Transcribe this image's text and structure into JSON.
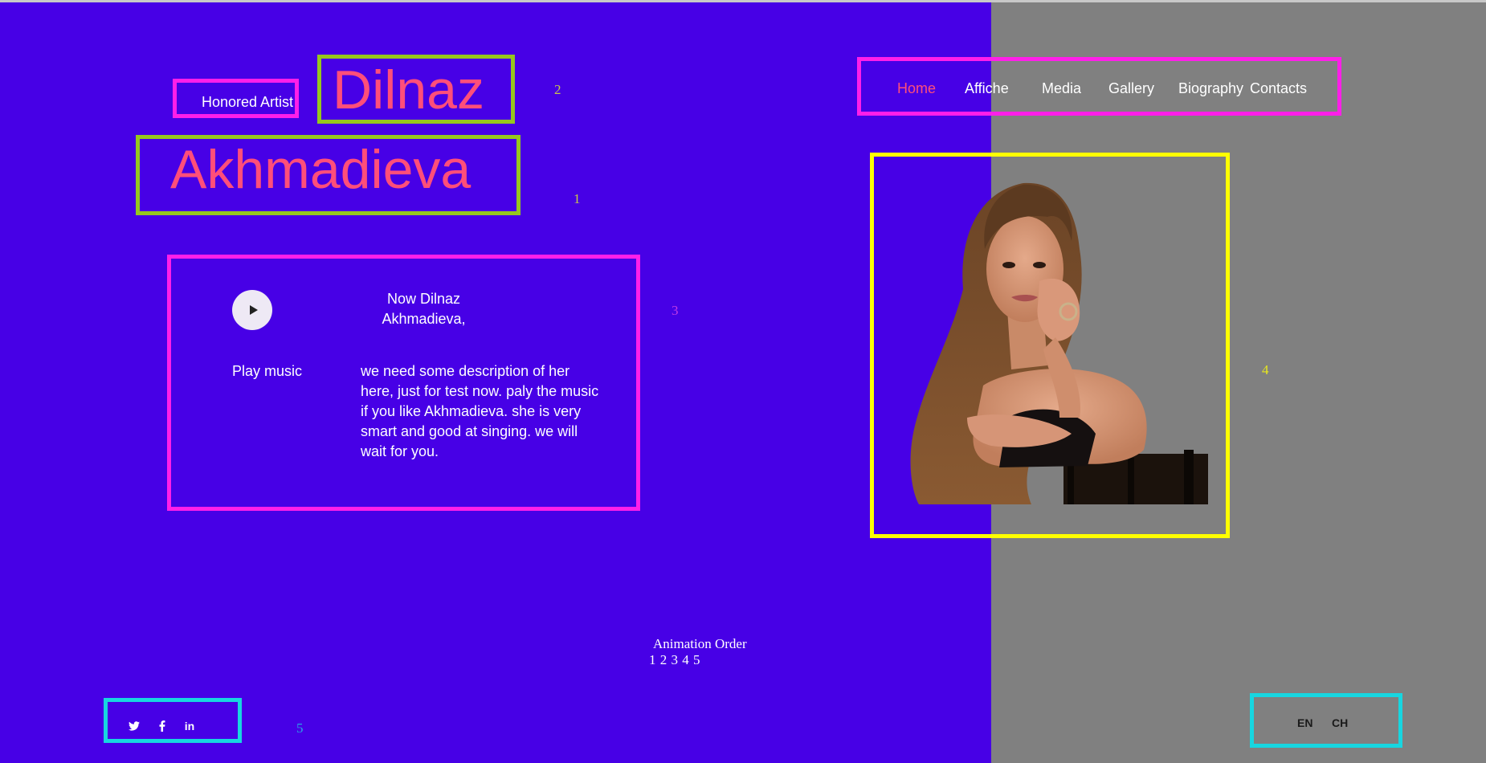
{
  "header": {
    "honored_label": "Honored Artist",
    "first_name": "Dilnaz",
    "last_name": "Akhmadieva"
  },
  "nav": {
    "items": [
      {
        "label": "Home",
        "active": true
      },
      {
        "label": "Affiche",
        "active": false
      },
      {
        "label": "Media",
        "active": false
      },
      {
        "label": "Gallery",
        "active": false
      },
      {
        "label": "Biography",
        "active": false
      },
      {
        "label": "Contacts",
        "active": false
      }
    ]
  },
  "player": {
    "play_label": "Play music",
    "now_line1": "Now Dilnaz",
    "now_line2": "Akhmadieva,",
    "description": "we need some description of her here, just for test now. paly the music if you like Akhmadieva. she is very smart and good at singing. we will wait for you."
  },
  "markers": {
    "m1": "1",
    "m2": "2",
    "m3": "3",
    "m4": "4",
    "m5": "5"
  },
  "animation": {
    "title": "Animation Order",
    "order": "1 2 3 4 5"
  },
  "social": {
    "items": [
      {
        "icon": "twitter-icon"
      },
      {
        "icon": "facebook-icon"
      },
      {
        "icon": "linkedin-icon",
        "text": "in"
      }
    ]
  },
  "language": {
    "en": "EN",
    "ch": "CH"
  },
  "colors": {
    "background": "#4700e6",
    "right_panel": "#808080",
    "accent_pink": "#ff4e7a",
    "frame_magenta": "#ff1fe9",
    "frame_green": "#96c71e",
    "frame_yellow": "#ffff00",
    "frame_cyan": "#17d6e0"
  }
}
